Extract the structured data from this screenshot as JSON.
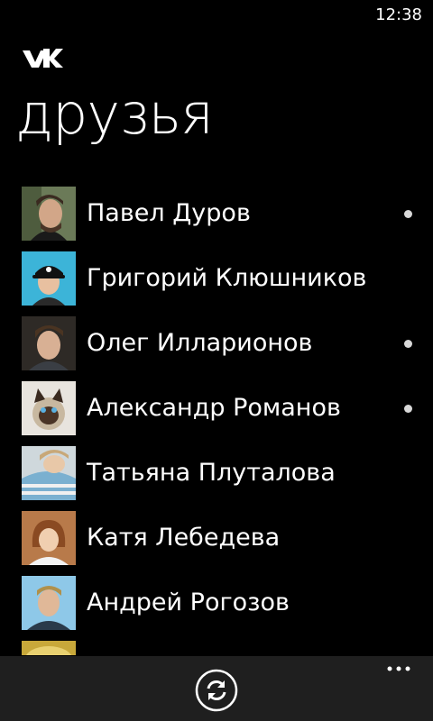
{
  "status_bar": {
    "time": "12:38"
  },
  "header": {
    "logo_icon": "vk-logo-icon",
    "title": "друзья"
  },
  "friends": [
    {
      "name": "Павел Дуров",
      "online": true,
      "avatar_icon": "avatar-pavel-icon"
    },
    {
      "name": "Григорий Клюшников",
      "online": false,
      "avatar_icon": "avatar-grigory-icon"
    },
    {
      "name": "Олег Илларионов",
      "online": true,
      "avatar_icon": "avatar-oleg-icon"
    },
    {
      "name": "Александр Романов",
      "online": true,
      "avatar_icon": "avatar-alexander-icon"
    },
    {
      "name": "Татьяна Плуталова",
      "online": false,
      "avatar_icon": "avatar-tatyana-icon"
    },
    {
      "name": "Катя Лебедева",
      "online": false,
      "avatar_icon": "avatar-katya-icon"
    },
    {
      "name": "Андрей Рогозов",
      "online": false,
      "avatar_icon": "avatar-andrey-icon"
    },
    {
      "name": "",
      "online": false,
      "avatar_icon": "avatar-partial-icon"
    }
  ],
  "app_bar": {
    "refresh_icon": "refresh-icon",
    "more_icon": "more-ellipsis-icon"
  },
  "colors": {
    "background": "#000000",
    "app_bar": "#1f1f1f",
    "text": "#ffffff",
    "online_dot": "#d8d8d8"
  }
}
